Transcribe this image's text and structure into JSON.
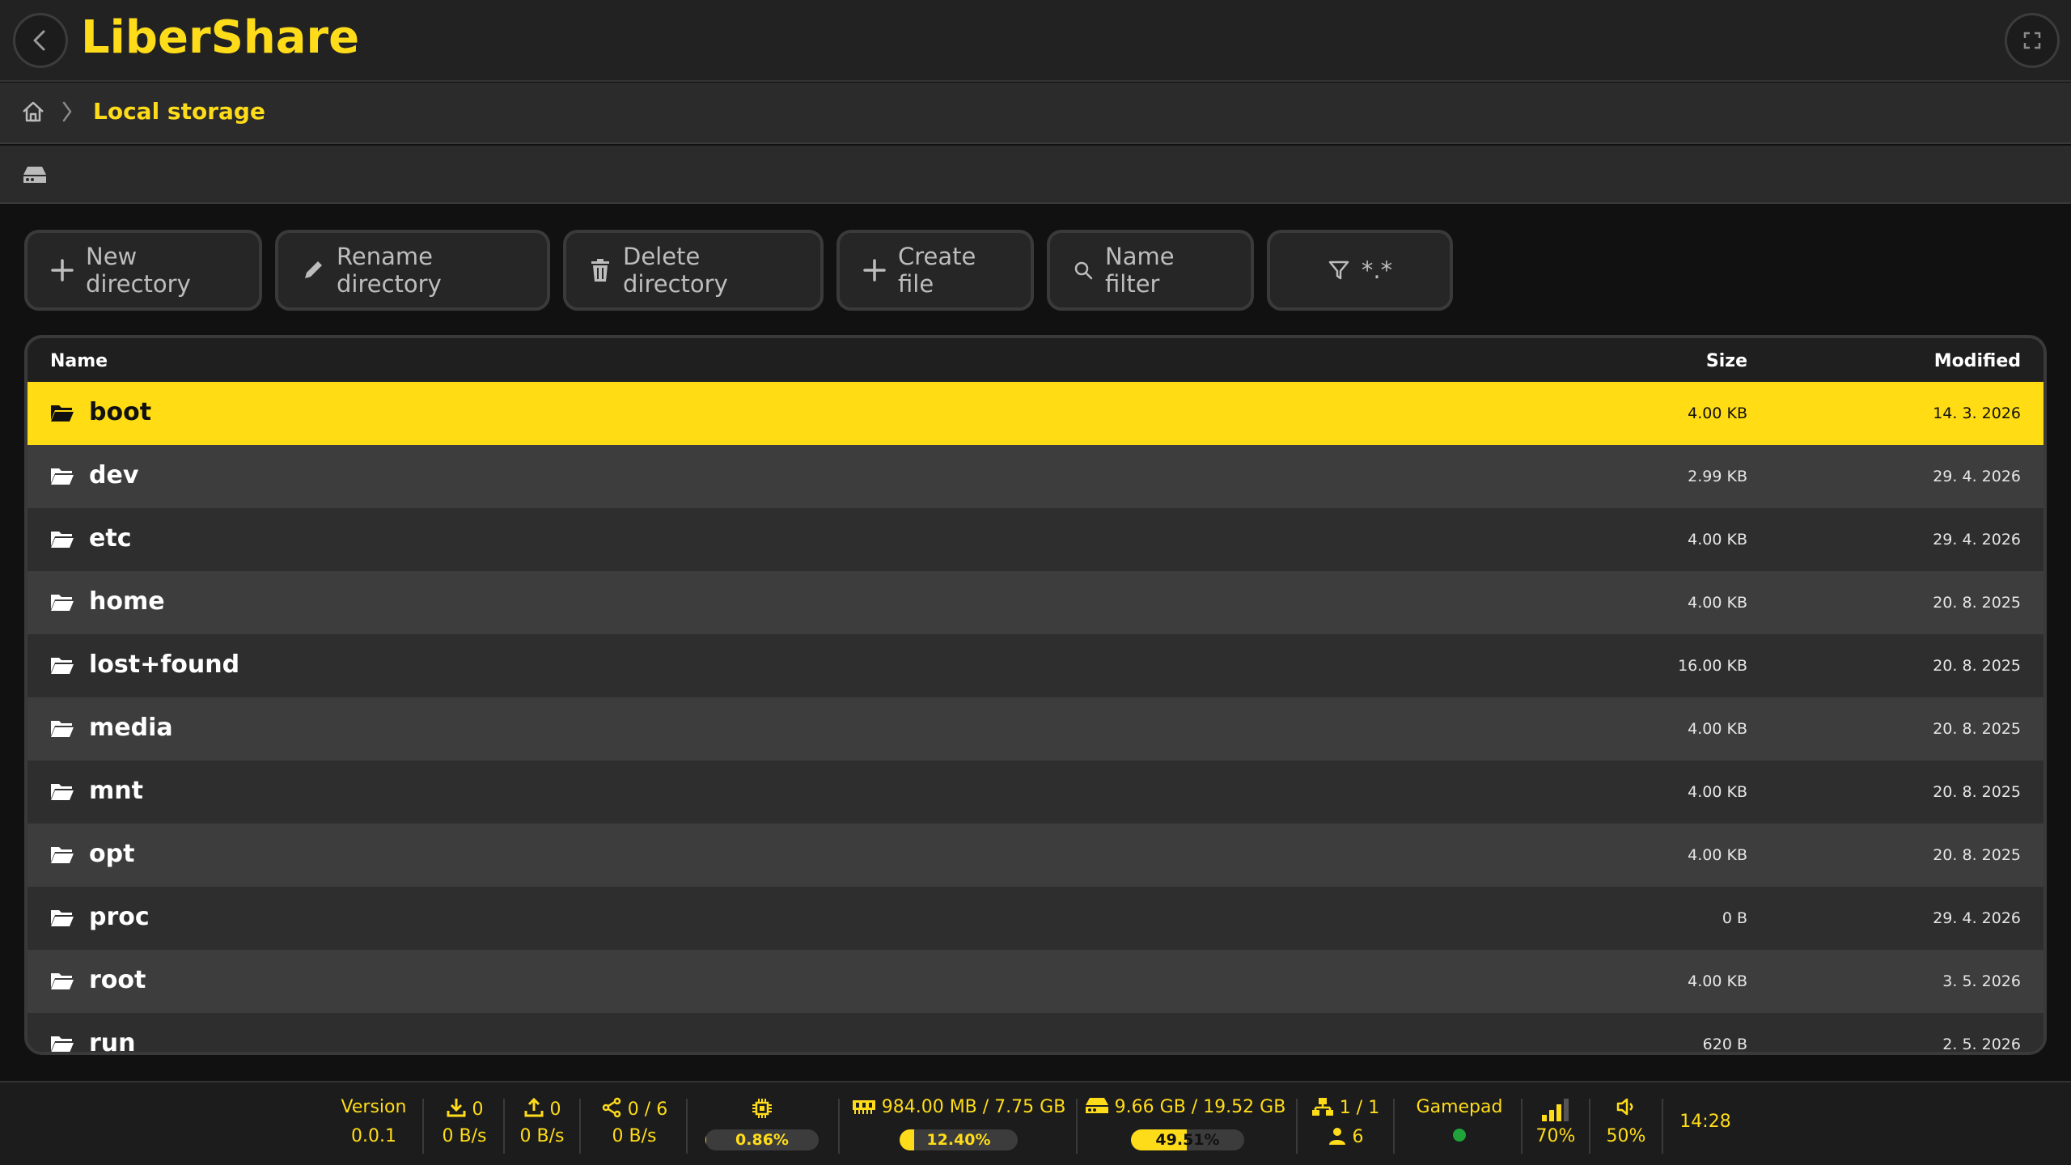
{
  "app": {
    "title": "LiberShare"
  },
  "breadcrumb": {
    "current": "Local storage"
  },
  "toolbar": {
    "new_directory": "New directory",
    "rename_directory": "Rename directory",
    "delete_directory": "Delete directory",
    "create_file": "Create file",
    "name_filter": "Name filter",
    "filter_pattern": "*.*"
  },
  "table": {
    "headers": {
      "name": "Name",
      "size": "Size",
      "modified": "Modified"
    },
    "rows": [
      {
        "name": "boot",
        "size": "4.00 KB",
        "modified": "14. 3. 2026",
        "selected": true
      },
      {
        "name": "dev",
        "size": "2.99 KB",
        "modified": "29. 4. 2026"
      },
      {
        "name": "etc",
        "size": "4.00 KB",
        "modified": "29. 4. 2026"
      },
      {
        "name": "home",
        "size": "4.00 KB",
        "modified": "20. 8. 2025"
      },
      {
        "name": "lost+found",
        "size": "16.00 KB",
        "modified": "20. 8. 2025"
      },
      {
        "name": "media",
        "size": "4.00 KB",
        "modified": "20. 8. 2025"
      },
      {
        "name": "mnt",
        "size": "4.00 KB",
        "modified": "20. 8. 2025"
      },
      {
        "name": "opt",
        "size": "4.00 KB",
        "modified": "20. 8. 2025"
      },
      {
        "name": "proc",
        "size": "0 B",
        "modified": "29. 4. 2026"
      },
      {
        "name": "root",
        "size": "4.00 KB",
        "modified": "3. 5. 2026"
      },
      {
        "name": "run",
        "size": "620 B",
        "modified": "2. 5. 2026"
      }
    ]
  },
  "status": {
    "version_label": "Version",
    "version": "0.0.1",
    "download_count": "0",
    "download_speed": "0 B/s",
    "upload_count": "0",
    "upload_speed": "0 B/s",
    "shares": "0 / 6",
    "share_speed": "0 B/s",
    "cpu_text": "0.86%",
    "cpu_percent": 0.86,
    "ram_text": "984.00 MB / 7.75 GB",
    "ram_percent_text": "12.40%",
    "ram_percent": 12.4,
    "disk_text": "9.66 GB / 19.52 GB",
    "disk_percent_text": "49.51%",
    "disk_percent": 49.51,
    "servers": "1 / 1",
    "users": "6",
    "gamepad_label": "Gamepad",
    "gamepad_color": "#1fa33a",
    "signal": "70%",
    "volume": "50%",
    "clock": "14:28"
  },
  "colors": {
    "accent": "#ffdc1a",
    "selected_row": "#ffdc14"
  }
}
